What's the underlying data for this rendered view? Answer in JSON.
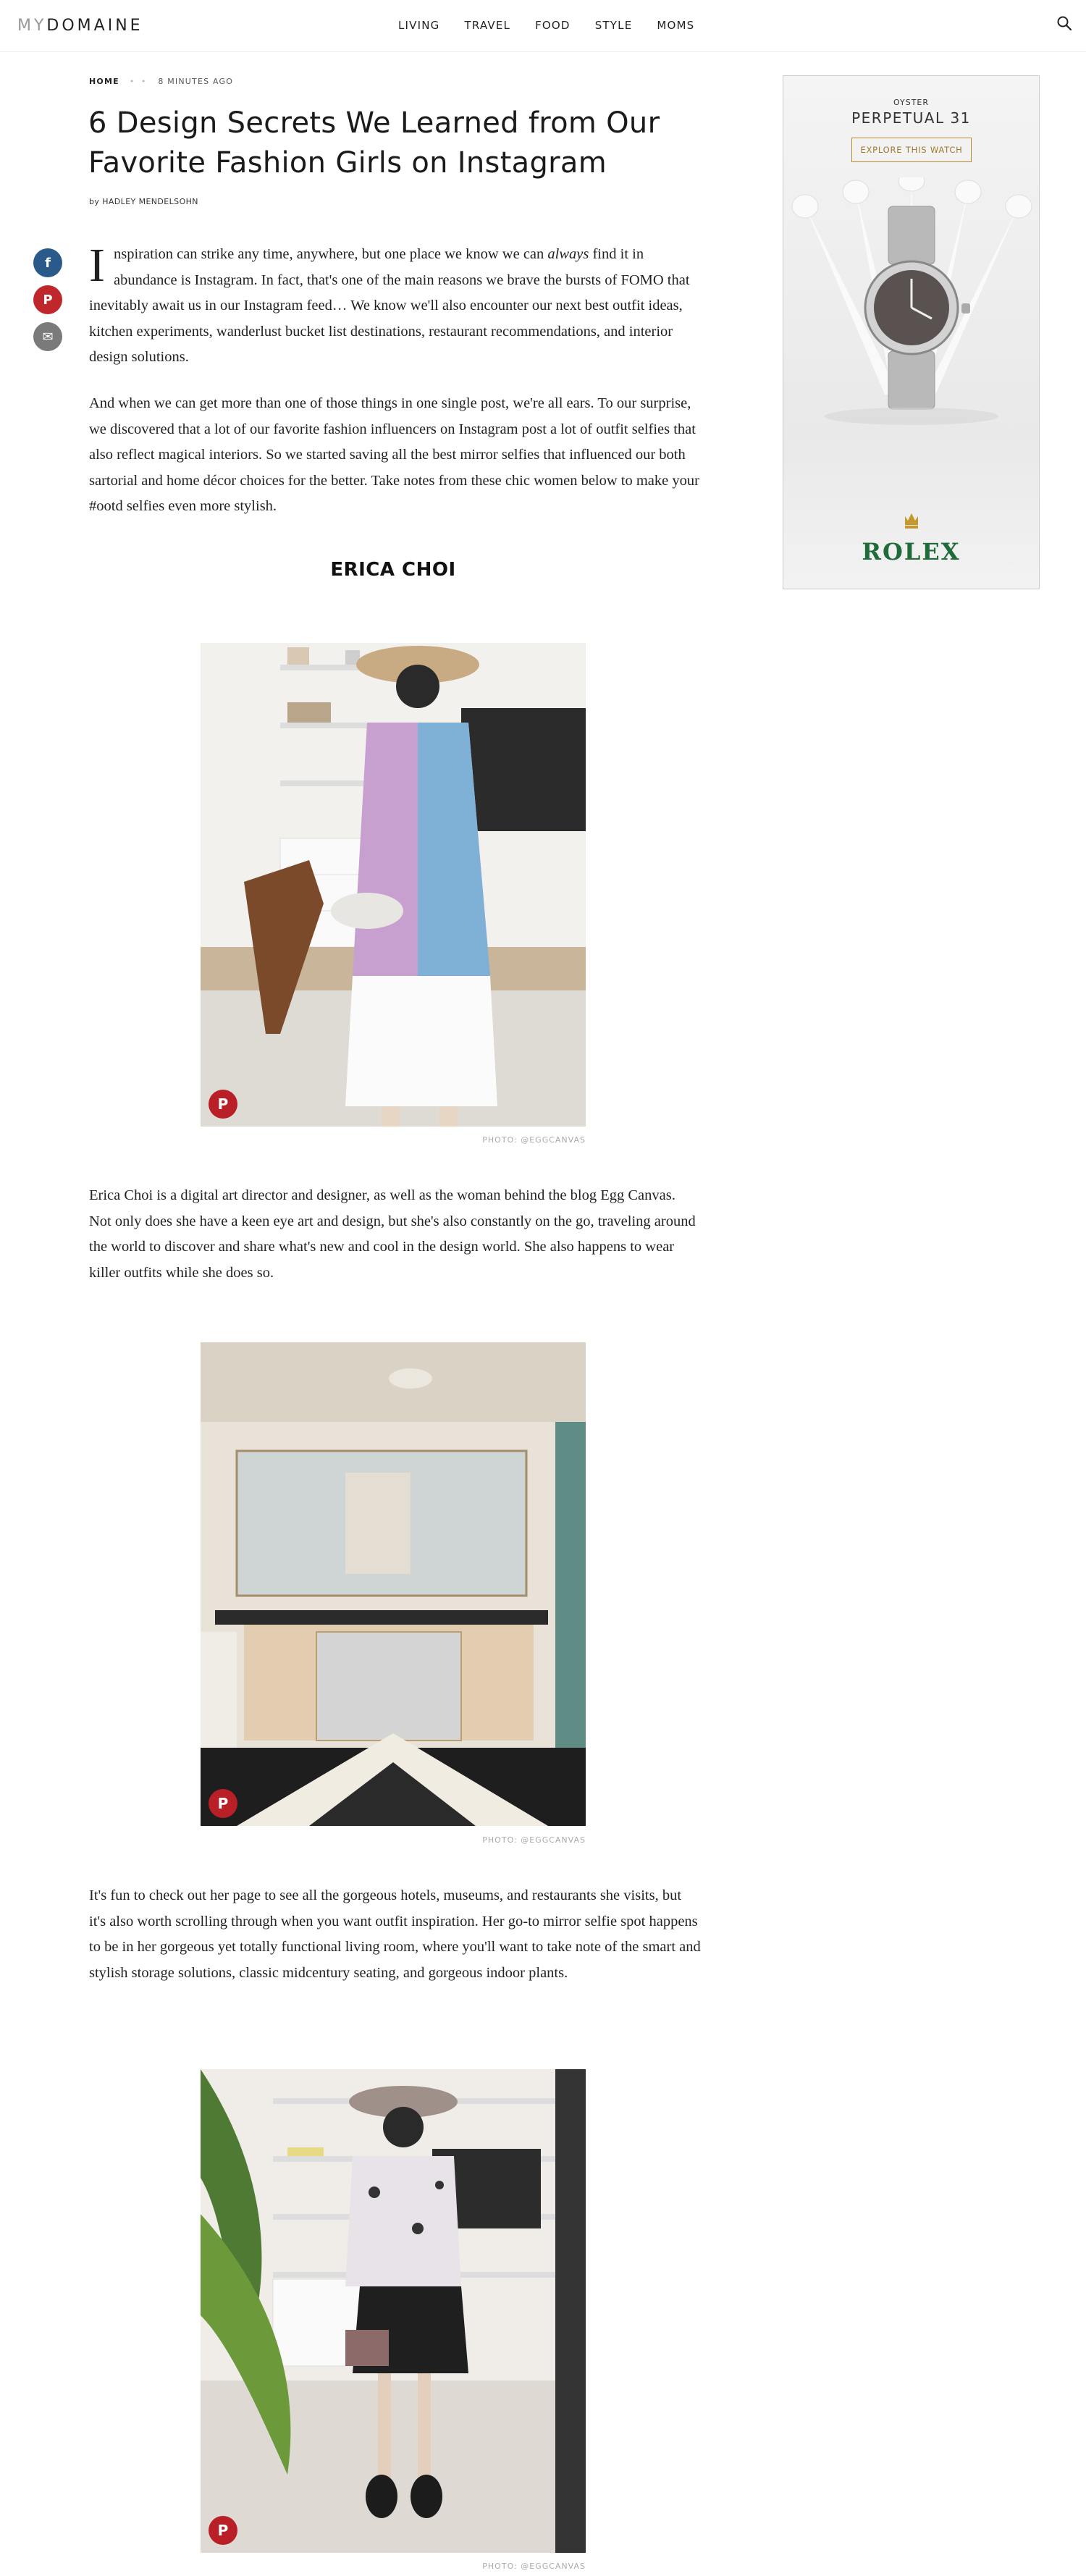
{
  "header": {
    "logo_prefix": "MY",
    "logo_main": "DOMAINE",
    "nav": [
      "LIVING",
      "TRAVEL",
      "FOOD",
      "STYLE",
      "MOMS"
    ],
    "search_icon": "search-icon"
  },
  "article": {
    "category": "HOME",
    "dots": "• •",
    "time": "8 MINUTES AGO",
    "title": "6 Design Secrets We Learned from Our Favorite Fashion Girls on Instagram",
    "byline_prefix": "by",
    "author": "HADLEY MENDELSOHN",
    "intro_dropcap": "I",
    "intro_1": "nspiration can strike any time, anywhere, but one place we know we can ",
    "intro_em": "always",
    "intro_2": " find it in abundance is Instagram. In fact, that's one of the main reasons we brave the bursts of FOMO that inevitably await us in our Instagram feed… We know we'll also encounter our next best outfit ideas, kitchen experiments, wanderlust bucket list destinations, restaurant recommendations, and interior design solutions.",
    "para_2": "And when we can get more than one of those things in one single post, we're all ears. To our surprise, we discovered that a lot of our favorite fashion influencers on Instagram post a lot of outfit selfies that also reflect magical interiors. So we started saving all the best mirror selfies that influenced our both sartorial and home décor choices for the better. Take notes from these chic women below to make your #ootd selfies even more stylish.",
    "section_title": "ERICA CHOI",
    "photo_credit_1": "PHOTO: @EGGCANVAS",
    "para_3": "Erica Choi is a digital art director and designer, as well as the woman behind the blog Egg Canvas. Not only does she have a keen eye art and design, but she's also constantly on the go, traveling around the world to discover and share what's new and cool in the design world. She also happens to wear killer outfits while she does so.",
    "photo_credit_2": "PHOTO: @EGGCANVAS",
    "para_4": "It's fun to check out her page to see all the gorgeous hotels, museums, and restaurants she visits, but it's also worth scrolling through when you want outfit inspiration. Her go-to mirror selfie spot happens to be in her gorgeous yet totally functional living room, where you'll want to take note of the smart and stylish storage solutions, classic midcentury seating, and gorgeous indoor plants.",
    "photo_credit_3": "PHOTO: @EGGCANVAS"
  },
  "share": {
    "facebook": "f",
    "pinterest": "P",
    "email": "✉"
  },
  "pin_badge": "P",
  "ad": {
    "line_1": "OYSTER",
    "line_2": "PERPETUAL 31",
    "cta": "EXPLORE THIS WATCH",
    "brand": "ROLEX"
  }
}
